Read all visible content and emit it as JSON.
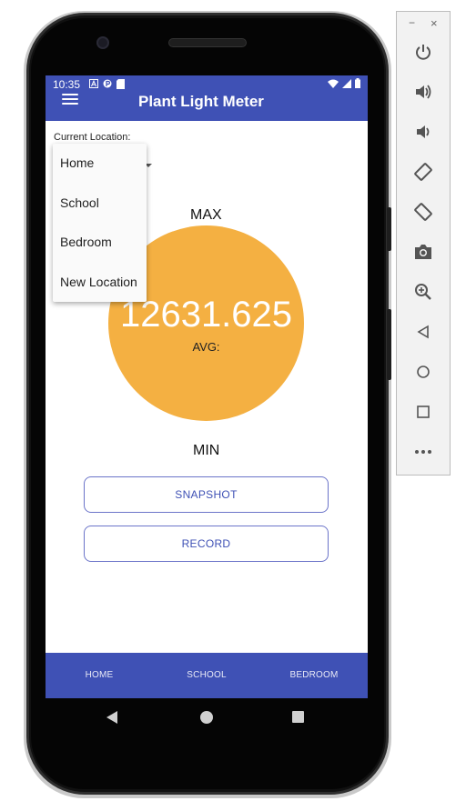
{
  "status_bar": {
    "time": "10:35",
    "left_icons": [
      "a-icon",
      "p-icon",
      "sd-card-icon"
    ],
    "right_icons": [
      "wifi-icon",
      "signal-icon",
      "battery-icon"
    ]
  },
  "app_bar": {
    "title": "Plant Light Meter"
  },
  "location": {
    "label": "Current Location:",
    "options": [
      "Home",
      "School",
      "Bedroom",
      "New Location"
    ]
  },
  "meter": {
    "max_label": "MAX",
    "value": "12631.625",
    "avg_label": "AVG:",
    "min_label": "MIN",
    "gauge_color": "#f4b042"
  },
  "buttons": {
    "snapshot": "SNAPSHOT",
    "record": "RECORD"
  },
  "bottom_nav": {
    "items": [
      "HOME",
      "SCHOOL",
      "BEDROOM"
    ]
  },
  "colors": {
    "primary": "#3f51b5",
    "accent_outline": "#6b74c9"
  },
  "emulator_toolbar": {
    "minimize": "−",
    "close": "×",
    "icons": [
      "power-icon",
      "volume-up-icon",
      "volume-down-icon",
      "rotate-left-icon",
      "rotate-right-icon",
      "camera-icon",
      "zoom-icon",
      "back-icon",
      "home-icon",
      "overview-icon",
      "more-icon"
    ]
  }
}
